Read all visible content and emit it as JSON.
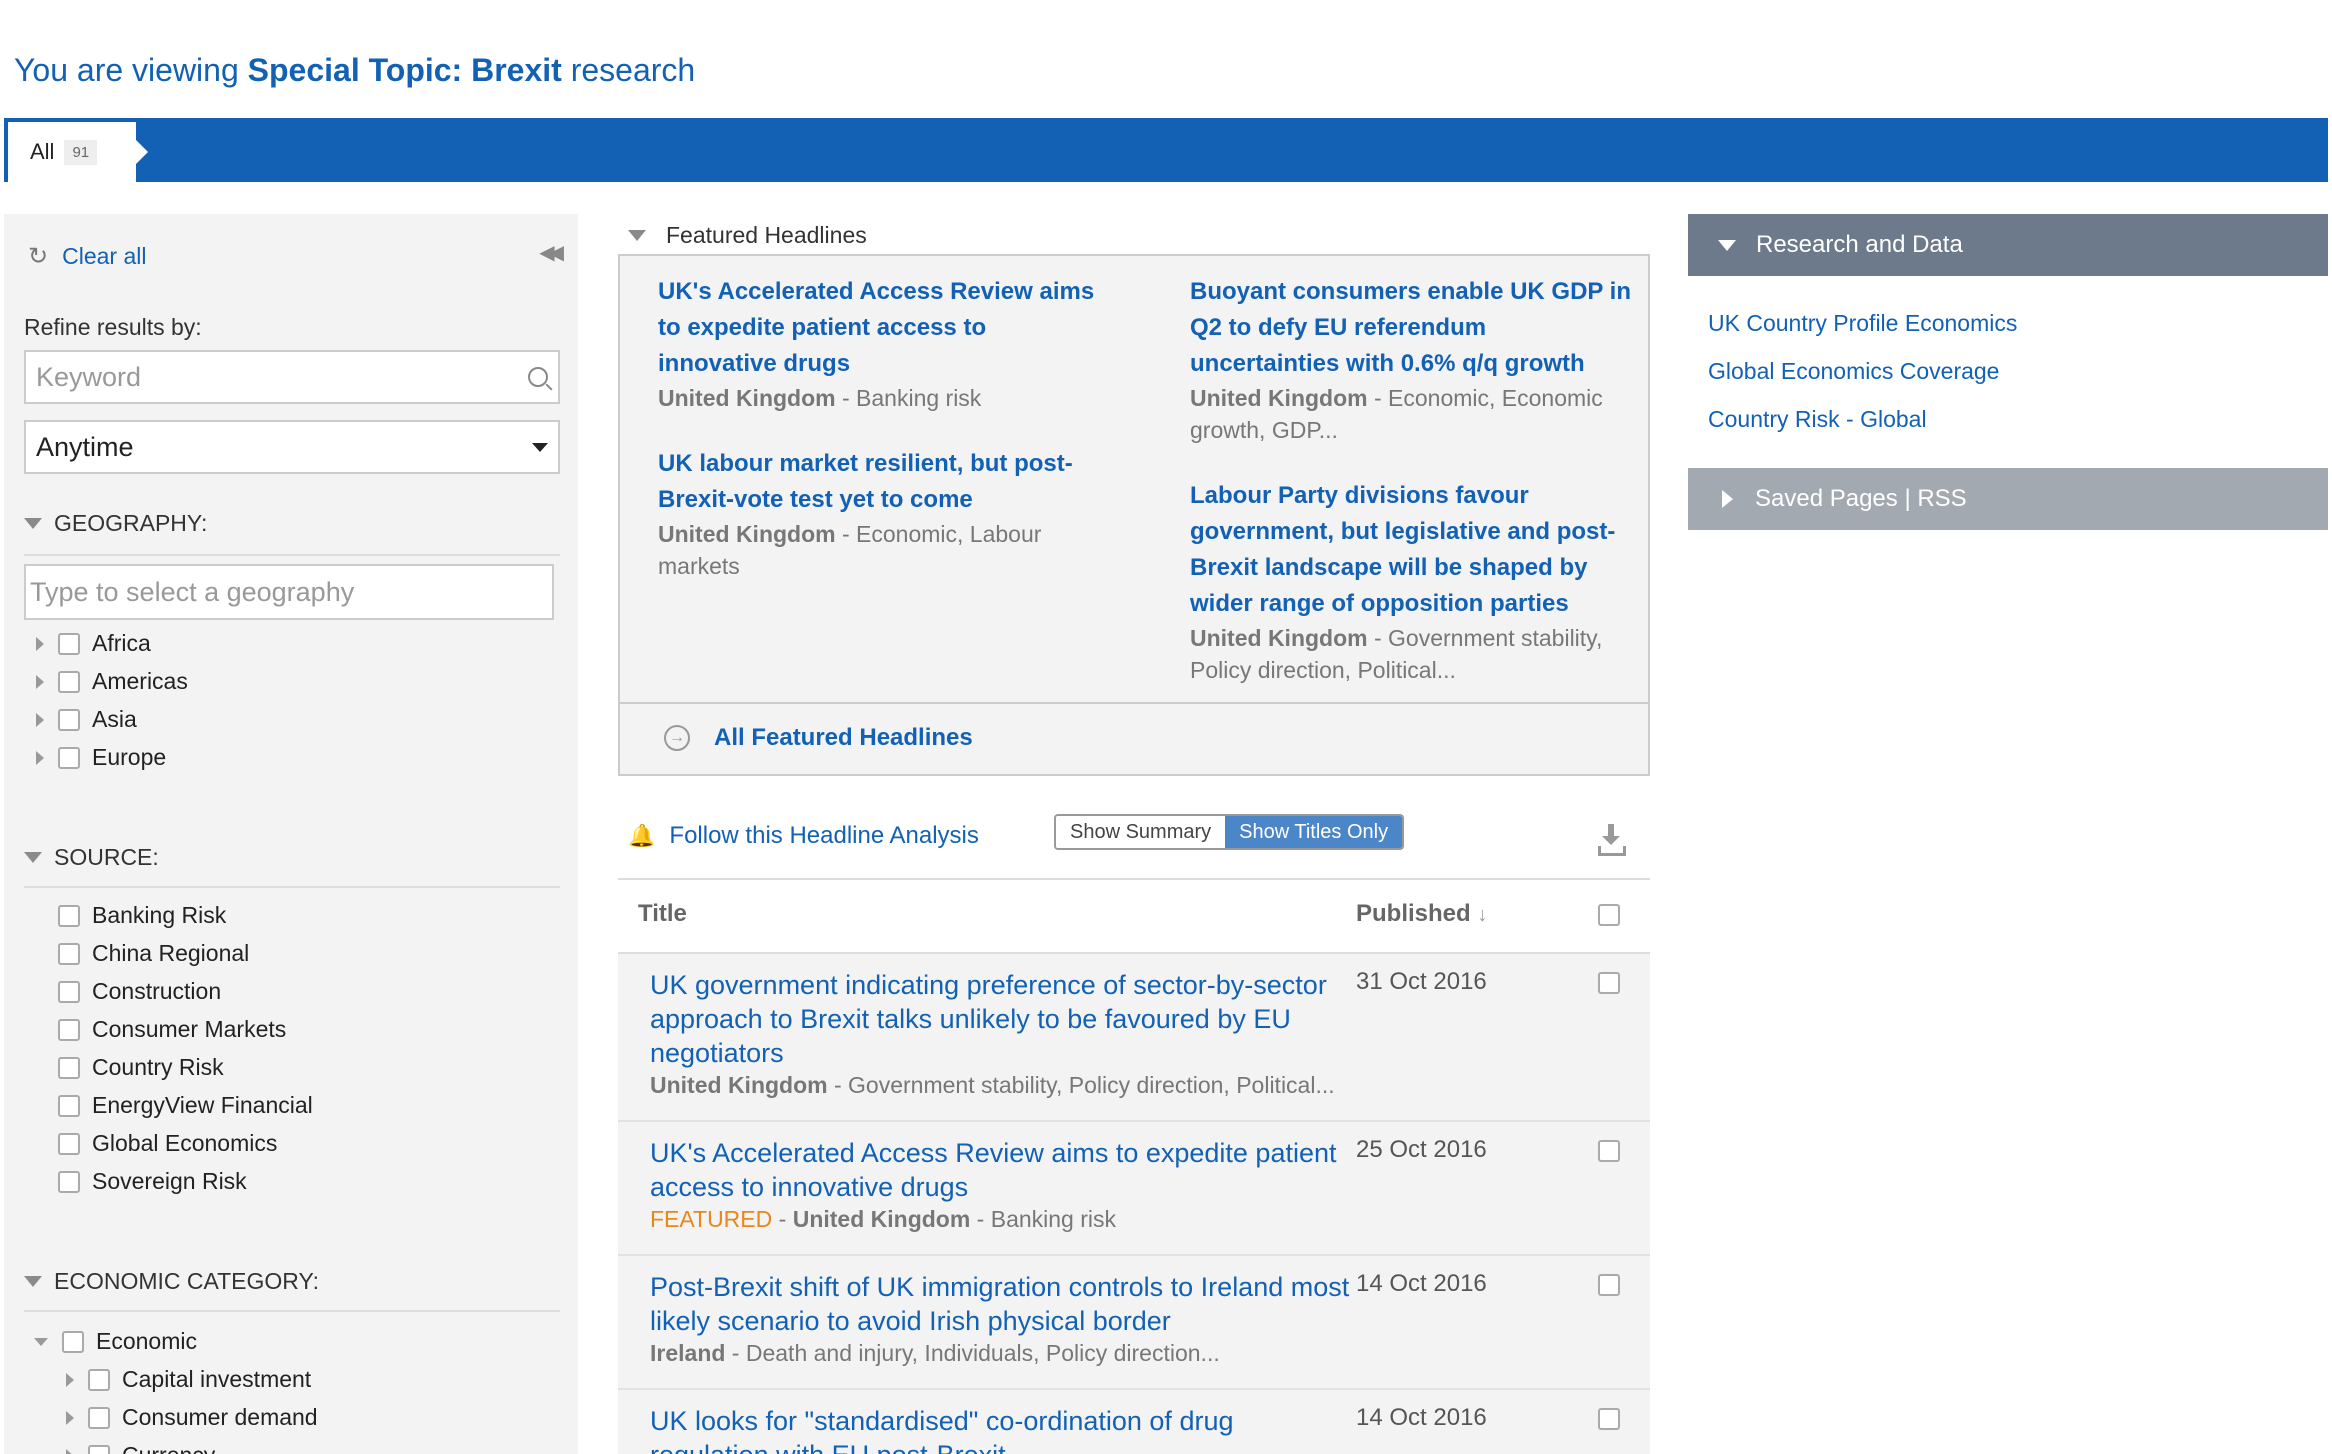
{
  "heading": {
    "prefix": "You are viewing ",
    "topic": "Special Topic: Brexit",
    "suffix": " research"
  },
  "tabs": [
    {
      "label": "All",
      "count": "91"
    }
  ],
  "sidebar": {
    "clear_all": "Clear all",
    "refine_label": "Refine results by:",
    "keyword_placeholder": "Keyword",
    "time_select": "Anytime",
    "geography": {
      "title": "GEOGRAPHY:",
      "placeholder": "Type to select a geography",
      "items": [
        "Africa",
        "Americas",
        "Asia",
        "Europe"
      ]
    },
    "source": {
      "title": "SOURCE:",
      "items": [
        "Banking Risk",
        "China Regional",
        "Construction",
        "Consumer Markets",
        "Country Risk",
        "EnergyView Financial",
        "Global Economics",
        "Sovereign Risk"
      ]
    },
    "economic_category": {
      "title": "ECONOMIC CATEGORY:",
      "parent": "Economic",
      "children": [
        "Capital investment",
        "Consumer demand",
        "Currency"
      ]
    }
  },
  "featured": {
    "title": "Featured Headlines",
    "items": [
      {
        "title": "UK's Accelerated Access Review aims to expedite patient access to innovative drugs",
        "country": "United Kingdom",
        "tags": " - Banking risk"
      },
      {
        "title": "UK labour market resilient, but post-Brexit-vote test yet to come",
        "country": "United Kingdom",
        "tags": " - Economic, Labour markets"
      },
      {
        "title": "Buoyant consumers enable UK GDP in Q2 to defy EU referendum uncertainties with 0.6% q/q growth",
        "country": "United Kingdom",
        "tags": " - Economic, Economic growth, GDP..."
      },
      {
        "title": "Labour Party divisions favour government, but legislative and post-Brexit landscape will be shaped by wider range of opposition parties",
        "country": "United Kingdom",
        "tags": " - Government stability, Policy direction, Political..."
      }
    ],
    "all_link": "All Featured Headlines"
  },
  "toolbar": {
    "follow": "Follow this Headline Analysis",
    "show_summary": "Show Summary",
    "show_titles": "Show Titles Only"
  },
  "table": {
    "col_title": "Title",
    "col_published": "Published",
    "sort_arrow": "↓",
    "rows": [
      {
        "title": "UK government indicating preference of sector-by-sector approach to Brexit talks unlikely to be favoured by EU negotiators",
        "featured": "",
        "country": "United Kingdom",
        "tags": " - Government stability, Policy direction, Political...",
        "date": "31 Oct 2016"
      },
      {
        "title": "UK's Accelerated Access Review aims to expedite patient access to innovative drugs",
        "featured": "FEATURED",
        "country": "United Kingdom",
        "tags": " - Banking risk",
        "date": "25 Oct 2016"
      },
      {
        "title": "Post-Brexit shift of UK immigration controls to Ireland most likely scenario to avoid Irish physical border",
        "featured": "",
        "country": "Ireland",
        "tags": " - Death and injury, Individuals, Policy direction...",
        "date": "14 Oct 2016"
      },
      {
        "title": "UK looks for \"standardised\" co-ordination of drug regulation with EU post-Brexit",
        "featured": "",
        "country": "",
        "tags": "",
        "date": "14 Oct 2016"
      }
    ]
  },
  "right_panel": {
    "research_title": "Research and Data",
    "links": [
      "UK Country Profile Economics",
      "Global Economics Coverage",
      "Country Risk - Global"
    ],
    "saved_title": "Saved Pages | RSS"
  },
  "colors": {
    "brand_blue": "#1261b4",
    "panel_grey": "#6d7a8b",
    "featured_orange": "#e8881a"
  }
}
